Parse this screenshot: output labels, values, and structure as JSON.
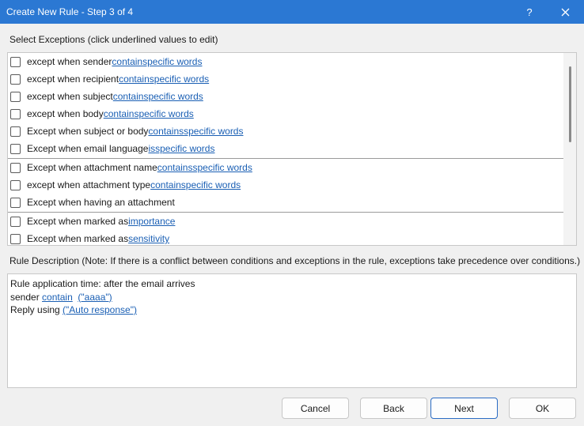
{
  "window": {
    "title": "Create New Rule - Step 3 of 4",
    "help_glyph": "?",
    "close_glyph": "✕"
  },
  "exceptions": {
    "label": "Select Exceptions (click underlined values to edit)",
    "groups": [
      [
        {
          "text": "except when sender",
          "links": [
            "contain",
            "specific words"
          ]
        },
        {
          "text": "except when recipient",
          "links": [
            "contain",
            "specific words"
          ]
        },
        {
          "text": "except when subject",
          "links": [
            "contain",
            "specific words"
          ]
        },
        {
          "text": "except when body",
          "links": [
            "contain",
            "specific words"
          ]
        },
        {
          "text": "Except when subject or body",
          "links": [
            "contains",
            "specific words"
          ]
        },
        {
          "text": "Except when email language",
          "links": [
            "is",
            "specific words"
          ]
        }
      ],
      [
        {
          "text": "Except when attachment name",
          "links": [
            "contains",
            "specific words"
          ]
        },
        {
          "text": "except when attachment type",
          "links": [
            "contain",
            "specific words"
          ]
        },
        {
          "text": "Except when having an attachment",
          "links": []
        }
      ],
      [
        {
          "text": "Except when marked as",
          "links": [
            "importance"
          ]
        },
        {
          "text": "Except when marked as",
          "links": [
            "sensitivity"
          ]
        }
      ]
    ]
  },
  "description": {
    "label": "Rule Description (Note: If there is a conflict between conditions and exceptions in the rule, exceptions take precedence over conditions.)",
    "line1": "Rule application time: after the email arrives",
    "line2_prefix": "sender",
    "line2_link1": "contain",
    "line2_link2": "(\"aaaa\")",
    "line3_prefix": "Reply using",
    "line3_link": "(\"Auto response\")"
  },
  "buttons": {
    "cancel": "Cancel",
    "back": "Back",
    "next": "Next",
    "ok": "OK"
  }
}
